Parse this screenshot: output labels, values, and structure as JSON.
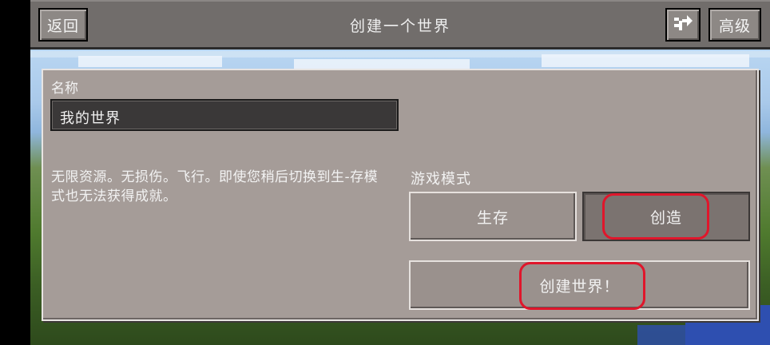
{
  "header": {
    "back_label": "返回",
    "title": "创建一个世界",
    "advanced_label": "高级",
    "shuffle_icon": "shuffle-arrows-icon"
  },
  "form": {
    "name_label": "名称",
    "name_value": "我的世界",
    "mode_description": "无限资源。无损伤。飞行。即使您稍后切换到生-存模式也无法获得成就。",
    "mode_label": "游戏模式",
    "survival_label": "生存",
    "creative_label": "创造",
    "selected_mode": "创造",
    "create_world_label": "创建世界！"
  },
  "colors": {
    "annotation": "#e0162b",
    "panel": "#a59c98",
    "header": "#716d6b"
  }
}
